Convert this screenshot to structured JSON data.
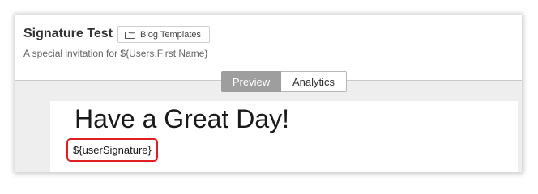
{
  "header": {
    "title": "Signature Test",
    "folder": {
      "icon": "folder-icon",
      "label": "Blog Templates"
    },
    "subtitle": "A special invitation for ${Users.First Name}"
  },
  "tabs": [
    {
      "label": "Preview",
      "active": true
    },
    {
      "label": "Analytics",
      "active": false
    }
  ],
  "preview": {
    "greeting": "Have a Great Day!",
    "signature_token": "${userSignature}"
  },
  "colors": {
    "active_tab": "#9e9e9e",
    "highlight_border": "#e02020",
    "content_background": "#eeeeee"
  }
}
